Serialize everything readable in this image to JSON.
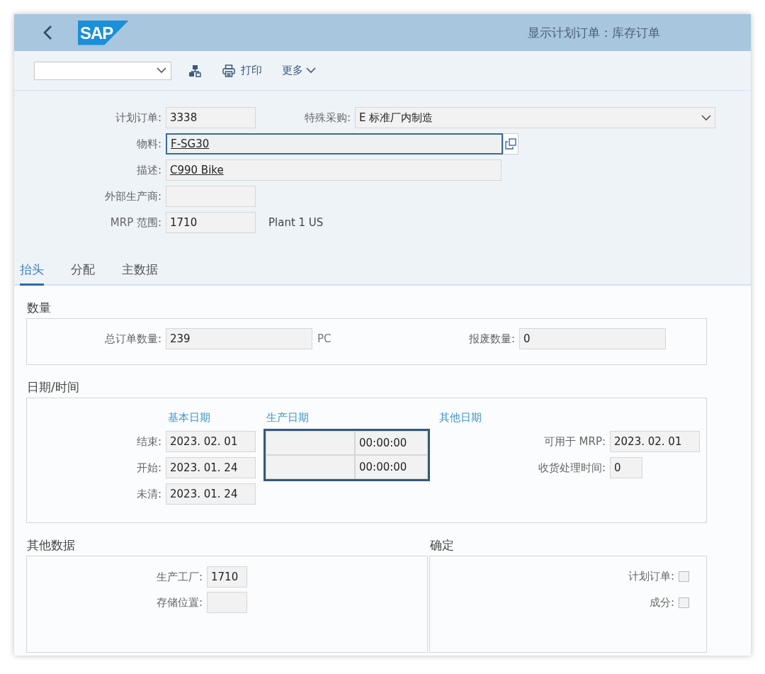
{
  "header": {
    "logo": "SAP",
    "title": "显示计划订单：库存订单"
  },
  "toolbar": {
    "print_label": "打印",
    "more_label": "更多"
  },
  "order_header": {
    "planned_order": {
      "label": "计划订单:",
      "value": "3338"
    },
    "special_procurement": {
      "label": "特殊采购:",
      "value": "E 标准厂内制造"
    },
    "material": {
      "label": "物料:",
      "value": "F-SG30",
      "focused": true
    },
    "description": {
      "label": "描述:",
      "value": "C990 Bike"
    },
    "external_manufacturer": {
      "label": "外部生产商:"
    },
    "mrp_area": {
      "label": "MRP 范围:",
      "value": "1710",
      "text": "Plant 1 US"
    }
  },
  "tabs": [
    {
      "label": "抬头",
      "selected": true
    },
    {
      "label": "分配",
      "selected": false
    },
    {
      "label": "主数据",
      "selected": false
    }
  ],
  "quantity": {
    "title": "数量",
    "total": {
      "label": "总订单数量:",
      "value": "239",
      "unit": "PC"
    },
    "scrap": {
      "label": "报废数量:",
      "value": "0"
    }
  },
  "dates": {
    "title": "日期/时间",
    "columns": [
      "基本日期",
      "生产日期",
      "其他日期"
    ],
    "rows": [
      {
        "label": "结束:",
        "basic": "2023. 02. 01",
        "production_time": "00:00:00"
      },
      {
        "label": "开始:",
        "basic": "2023. 01. 24",
        "production_time": "00:00:00"
      },
      {
        "label": "未清:",
        "basic": "2023. 01. 24"
      }
    ],
    "other": [
      {
        "label": "可用于 MRP:",
        "value": "2023. 02. 01"
      },
      {
        "label": "收货处理时间:",
        "value": "0"
      }
    ]
  },
  "other_data": {
    "title": "其他数据",
    "fields": [
      {
        "label": "生产工厂:",
        "value": "1710"
      },
      {
        "label": "存储位置:"
      }
    ]
  },
  "confirmation": {
    "title": "确定",
    "items": [
      {
        "label": "计划订单:",
        "checked": false
      },
      {
        "label": "成分:",
        "checked": false
      }
    ]
  }
}
